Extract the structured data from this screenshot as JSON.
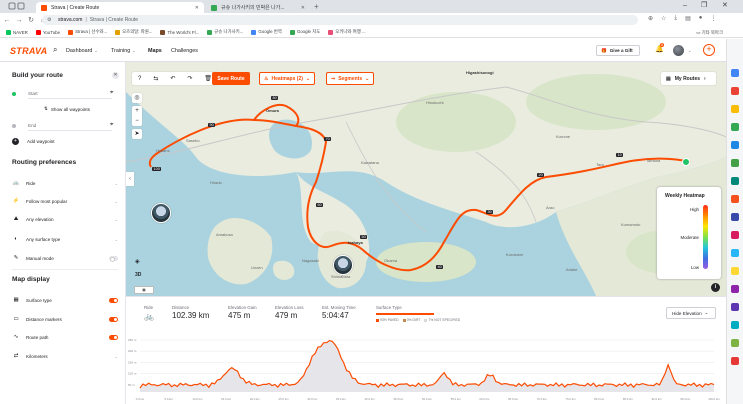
{
  "browser": {
    "tabs": [
      {
        "title": "Strava | Create Route",
        "favicon_color": "#fc4c02",
        "active": true
      },
      {
        "title": "규슈 나가사키의 민박은 나가...",
        "favicon_color": "#34a853",
        "active": false
      }
    ],
    "url": "strava.com",
    "page_title": "Strava | Create Route",
    "bookmarks": [
      {
        "label": "NAVER",
        "color": "#03c75a"
      },
      {
        "label": "YouTube",
        "color": "#ff0000"
      },
      {
        "label": "Strava | 선수와...",
        "color": "#fc4c02"
      },
      {
        "label": "오즈의달: 파원...",
        "color": "#e0a100"
      },
      {
        "label": "The World's Fl...",
        "color": "#7a4b2a"
      },
      {
        "label": "규슈 나가사키...",
        "color": "#34a853"
      },
      {
        "label": "Google 번역",
        "color": "#4285f4"
      },
      {
        "label": "Google 지도",
        "color": "#34a853"
      },
      {
        "label": "오키나와 여행 ...",
        "color": "#e94e77"
      }
    ],
    "bookmarks_right": "기타 북마크"
  },
  "header": {
    "logo": "STRAVA",
    "nav": [
      {
        "label": "Dashboard",
        "dropdown": true,
        "active": false
      },
      {
        "label": "Training",
        "dropdown": true,
        "active": false
      },
      {
        "label": "Maps",
        "dropdown": false,
        "active": true
      },
      {
        "label": "Challenges",
        "dropdown": false,
        "active": false
      }
    ],
    "gift_label": "Give a Gift",
    "notification_count": "8"
  },
  "sidebar": {
    "build_title": "Build your route",
    "start_placeholder": "Start",
    "show_waypoints": "Show all waypoints",
    "end_placeholder": "End",
    "add_waypoint": "Add waypoint",
    "routing_title": "Routing preferences",
    "routing": [
      {
        "icon": "bike-icon",
        "label": "Ride"
      },
      {
        "icon": "popular-icon",
        "label": "Follow most popular"
      },
      {
        "icon": "elevation-icon",
        "label": "Any elevation"
      },
      {
        "icon": "surface-icon",
        "label": "Any surface type"
      },
      {
        "icon": "manual-icon",
        "label": "Manual mode",
        "toggle": false
      }
    ],
    "display_title": "Map display",
    "display": [
      {
        "icon": "surface-type-icon",
        "label": "Surface type",
        "toggle": true
      },
      {
        "icon": "distance-marker-icon",
        "label": "Distance markers",
        "toggle": true
      },
      {
        "icon": "route-path-icon",
        "label": "Route path",
        "toggle": true
      },
      {
        "icon": "units-icon",
        "label": "Kilometers",
        "toggle": null
      }
    ]
  },
  "map": {
    "save_label": "Save Route",
    "heatmaps_label": "Heatmaps (2)",
    "segments_label": "Segments",
    "my_routes_label": "My Routes",
    "heatmap_title": "Weekly Heatmap",
    "heatmap_high": "High",
    "heatmap_moderate": "Moderate",
    "heatmap_low": "Low",
    "btn_3d": "3D",
    "place_labels": [
      {
        "text": "Higashisonogi"
      },
      {
        "text": "Hasami"
      },
      {
        "text": "Omura"
      },
      {
        "text": "Kawatana"
      },
      {
        "text": "Hirado"
      },
      {
        "text": "Kurume"
      },
      {
        "text": "Isahaya"
      },
      {
        "text": "Tara"
      },
      {
        "text": "Unzen"
      },
      {
        "text": "Shimabara"
      },
      {
        "text": "Amakusa"
      },
      {
        "text": "Kumamoto"
      },
      {
        "text": "Arao"
      },
      {
        "text": "Tamana"
      },
      {
        "text": "Kurokami"
      },
      {
        "text": "Sasebo"
      },
      {
        "text": "Hinokuchi"
      },
      {
        "text": "Obama"
      },
      {
        "text": "Ariake"
      },
      {
        "text": "Nagasaki"
      }
    ],
    "km_markers": [
      "90",
      "80",
      "70",
      "60",
      "50",
      "40",
      "30",
      "20",
      "10",
      "100"
    ]
  },
  "stats": {
    "sport_label": "Ride",
    "distance_label": "Distance",
    "distance_value": "102.39 km",
    "gain_label": "Elevation Gain",
    "gain_value": "475 m",
    "loss_label": "Elevation Loss",
    "loss_value": "479 m",
    "time_label": "Est. Moving Time",
    "time_value": "5:04:47",
    "surface_label": "Surface Type",
    "surface_legend": [
      {
        "label": "93% PAVED",
        "color": "#fc4c02"
      },
      {
        "label": "0% DIRT",
        "color": "#c58a52"
      },
      {
        "label": "7% NOT SPECIFIED",
        "color": "#d9d9d9"
      }
    ],
    "hide_elevation": "Hide Elevation"
  },
  "elevation": {
    "y_ticks": [
      "250 m",
      "200 m",
      "150 m",
      "100 m",
      "50 m"
    ],
    "x_ticks": [
      "0.0 km",
      "5.0 km",
      "10.0 km",
      "15.0 km",
      "20.0 km",
      "25.0 km",
      "30.0 km",
      "35.0 km",
      "40.0 km",
      "45.0 km",
      "50.0 km",
      "55.0 km",
      "60.0 km",
      "65.0 km",
      "70.0 km",
      "75.0 km",
      "80.0 km",
      "85.0 km",
      "90.0 km",
      "95.0 km",
      "100.0 km"
    ]
  }
}
